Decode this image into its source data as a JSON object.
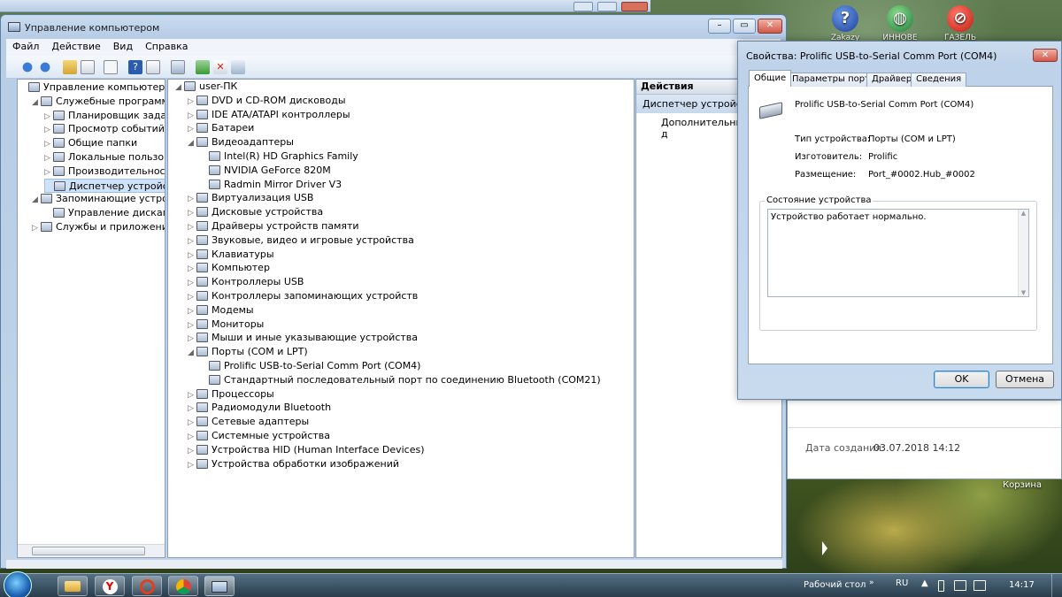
{
  "desktop": {
    "icons": [
      {
        "name": "help",
        "label": "Zakazy"
      },
      {
        "name": "browser",
        "label": "ИННОВЕ"
      },
      {
        "name": "stop",
        "label": "ГАЗЕЛЬ"
      }
    ],
    "recycle": "Корзина"
  },
  "mmc": {
    "title": "Управление компьютером",
    "menu": [
      "Файл",
      "Действие",
      "Вид",
      "Справка"
    ],
    "left_tree": [
      {
        "label": "Управление компьютером (л",
        "level": 0,
        "icon": "computer-icon",
        "expand": ""
      },
      {
        "label": "Служебные программы",
        "level": 1,
        "icon": "tools-icon",
        "expand": "◢"
      },
      {
        "label": "Планировщик заданий",
        "level": 2,
        "icon": "clock-icon",
        "expand": "▷"
      },
      {
        "label": "Просмотр событий",
        "level": 2,
        "icon": "event-viewer-icon",
        "expand": "▷"
      },
      {
        "label": "Общие папки",
        "level": 2,
        "icon": "shared-folder-icon",
        "expand": "▷"
      },
      {
        "label": "Локальные пользовате",
        "level": 2,
        "icon": "users-icon",
        "expand": "▷"
      },
      {
        "label": "Производительность",
        "level": 2,
        "icon": "performance-icon",
        "expand": "▷"
      },
      {
        "label": "Диспетчер устройств",
        "level": 2,
        "icon": "device-manager-icon",
        "expand": "",
        "selected": true
      },
      {
        "label": "Запоминающие устройст",
        "level": 1,
        "icon": "storage-icon",
        "expand": "◢"
      },
      {
        "label": "Управление дисками",
        "level": 2,
        "icon": "disk-icon",
        "expand": ""
      },
      {
        "label": "Службы и приложения",
        "level": 1,
        "icon": "services-icon",
        "expand": "▷"
      }
    ],
    "device_tree": [
      {
        "label": "user-ПК",
        "level": 0,
        "expand": "◢",
        "icon": "computer-icon"
      },
      {
        "label": "DVD и CD-ROM дисководы",
        "level": 1,
        "expand": "▷",
        "icon": "dvd-icon"
      },
      {
        "label": "IDE ATA/ATAPI контроллеры",
        "level": 1,
        "expand": "▷",
        "icon": "ide-icon"
      },
      {
        "label": "Батареи",
        "level": 1,
        "expand": "▷",
        "icon": "battery-icon"
      },
      {
        "label": "Видеоадаптеры",
        "level": 1,
        "expand": "◢",
        "icon": "display-adapter-icon"
      },
      {
        "label": "Intel(R) HD Graphics Family",
        "level": 2,
        "expand": "",
        "icon": "display-adapter-icon"
      },
      {
        "label": "NVIDIA GeForce 820M",
        "level": 2,
        "expand": "",
        "icon": "display-adapter-icon"
      },
      {
        "label": "Radmin Mirror Driver V3",
        "level": 2,
        "expand": "",
        "icon": "display-adapter-icon"
      },
      {
        "label": "Виртуализация USB",
        "level": 1,
        "expand": "▷",
        "icon": "usb-icon"
      },
      {
        "label": "Дисковые устройства",
        "level": 1,
        "expand": "▷",
        "icon": "disk-icon"
      },
      {
        "label": "Драйверы устройств памяти",
        "level": 1,
        "expand": "▷",
        "icon": "memory-icon"
      },
      {
        "label": "Звуковые, видео и игровые устройства",
        "level": 1,
        "expand": "▷",
        "icon": "sound-icon"
      },
      {
        "label": "Клавиатуры",
        "level": 1,
        "expand": "▷",
        "icon": "keyboard-icon"
      },
      {
        "label": "Компьютер",
        "level": 1,
        "expand": "▷",
        "icon": "computer-icon"
      },
      {
        "label": "Контроллеры USB",
        "level": 1,
        "expand": "▷",
        "icon": "usb-icon"
      },
      {
        "label": "Контроллеры запоминающих устройств",
        "level": 1,
        "expand": "▷",
        "icon": "storage-icon"
      },
      {
        "label": "Модемы",
        "level": 1,
        "expand": "▷",
        "icon": "modem-icon"
      },
      {
        "label": "Мониторы",
        "level": 1,
        "expand": "▷",
        "icon": "monitor-icon"
      },
      {
        "label": "Мыши и иные указывающие устройства",
        "level": 1,
        "expand": "▷",
        "icon": "mouse-icon"
      },
      {
        "label": "Порты (COM и LPT)",
        "level": 1,
        "expand": "◢",
        "icon": "port-icon"
      },
      {
        "label": "Prolific USB-to-Serial Comm Port (COM4)",
        "level": 2,
        "expand": "",
        "icon": "port-icon"
      },
      {
        "label": "Стандартный последовательный порт по соединению Bluetooth (COM21)",
        "level": 2,
        "expand": "",
        "icon": "port-icon"
      },
      {
        "label": "Процессоры",
        "level": 1,
        "expand": "▷",
        "icon": "cpu-icon"
      },
      {
        "label": "Радиомодули Bluetooth",
        "level": 1,
        "expand": "▷",
        "icon": "bluetooth-icon"
      },
      {
        "label": "Сетевые адаптеры",
        "level": 1,
        "expand": "▷",
        "icon": "network-icon"
      },
      {
        "label": "Системные устройства",
        "level": 1,
        "expand": "▷",
        "icon": "system-icon"
      },
      {
        "label": "Устройства HID (Human Interface Devices)",
        "level": 1,
        "expand": "▷",
        "icon": "hid-icon"
      },
      {
        "label": "Устройства обработки изображений",
        "level": 1,
        "expand": "▷",
        "icon": "camera-icon"
      }
    ],
    "actions": {
      "header": "Действия",
      "item": "Диспетчер устройств",
      "more": "Дополнительные д"
    }
  },
  "dialog": {
    "title": "Свойства: Prolific USB-to-Serial Comm Port (COM4)",
    "tabs": [
      "Общие",
      "Параметры порта",
      "Драйвер",
      "Сведения"
    ],
    "device_name": "Prolific USB-to-Serial Comm Port (COM4)",
    "type_label": "Тип устройства:",
    "type_value": "Порты (COM и LPT)",
    "mfr_label": "Изготовитель:",
    "mfr_value": "Prolific",
    "loc_label": "Размещение:",
    "loc_value": "Port_#0002.Hub_#0002",
    "status_group": "Состояние устройства",
    "status_text": "Устройство работает нормально.",
    "ok": "OK",
    "cancel": "Отмена"
  },
  "behind_window": {
    "date_label": "Дата создания:",
    "date_value": "03.07.2018 14:12"
  },
  "taskbar": {
    "desktop_label": "Рабочий стол",
    "lang": "RU",
    "time": "14:17"
  }
}
